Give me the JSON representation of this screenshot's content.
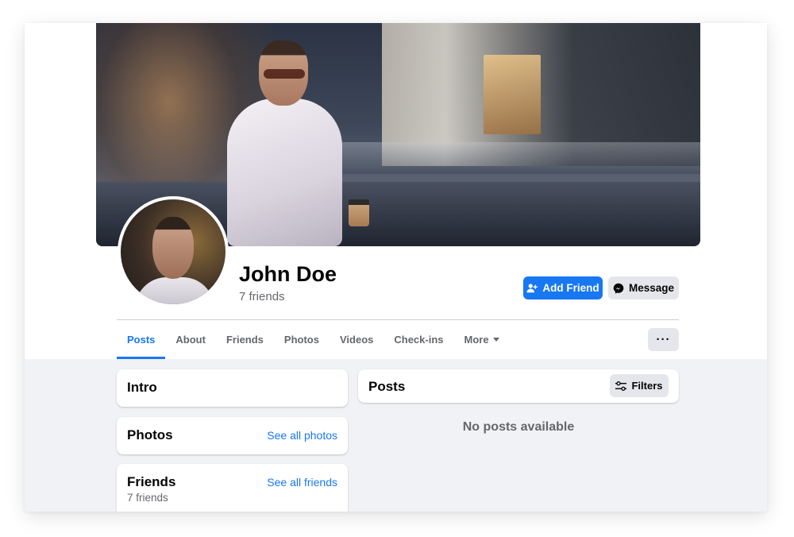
{
  "profile": {
    "name": "John Doe",
    "friends_count": "7 friends"
  },
  "actions": {
    "add_friend_label": "Add Friend",
    "message_label": "Message",
    "more_label": "···"
  },
  "tabs": [
    {
      "label": "Posts",
      "active": true
    },
    {
      "label": "About"
    },
    {
      "label": "Friends"
    },
    {
      "label": "Photos"
    },
    {
      "label": "Videos"
    },
    {
      "label": "Check-ins"
    },
    {
      "label": "More"
    }
  ],
  "sidebar": {
    "intro_title": "Intro",
    "photos_title": "Photos",
    "photos_link": "See all photos",
    "friends_title": "Friends",
    "friends_link": "See all friends",
    "friends_count": "7 friends"
  },
  "posts": {
    "title": "Posts",
    "filters_label": "Filters",
    "empty_message": "No posts available"
  },
  "colors": {
    "accent": "#1877f2",
    "secondary_button": "#e4e6eb",
    "feed_background": "#f0f2f5",
    "muted_text": "#65676b"
  },
  "icons": {
    "add_friend": "person-plus-icon",
    "message": "messenger-icon",
    "more": "ellipsis-icon",
    "tab_more": "caret-down-icon",
    "filters": "sliders-icon"
  }
}
